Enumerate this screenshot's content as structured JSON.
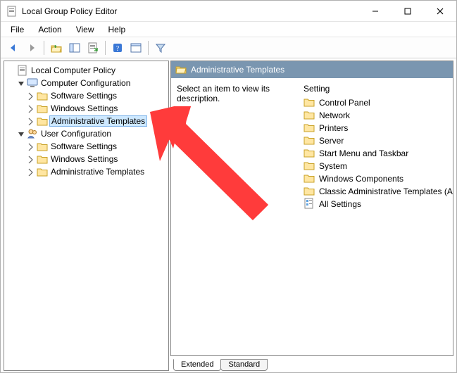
{
  "window": {
    "title": "Local Group Policy Editor"
  },
  "menu": {
    "file": "File",
    "action": "Action",
    "view": "View",
    "help": "Help"
  },
  "tree": {
    "root": "Local Computer Policy",
    "comp": "Computer Configuration",
    "comp_children": [
      "Software Settings",
      "Windows Settings",
      "Administrative Templates"
    ],
    "user": "User Configuration",
    "user_children": [
      "Software Settings",
      "Windows Settings",
      "Administrative Templates"
    ]
  },
  "content": {
    "header": "Administrative Templates",
    "desc": "Select an item to view its description.",
    "column": "Setting",
    "items": [
      {
        "label": "Control Panel",
        "icon": "folder"
      },
      {
        "label": "Network",
        "icon": "folder"
      },
      {
        "label": "Printers",
        "icon": "folder"
      },
      {
        "label": "Server",
        "icon": "folder"
      },
      {
        "label": "Start Menu and Taskbar",
        "icon": "folder"
      },
      {
        "label": "System",
        "icon": "folder"
      },
      {
        "label": "Windows Components",
        "icon": "folder"
      },
      {
        "label": "Classic Administrative Templates (ADM)",
        "icon": "folder"
      },
      {
        "label": "All Settings",
        "icon": "all-settings"
      }
    ]
  },
  "tabs": {
    "extended": "Extended",
    "standard": "Standard"
  },
  "annotation": {
    "arrow_target": "tree-node-comp-admin-templates"
  }
}
